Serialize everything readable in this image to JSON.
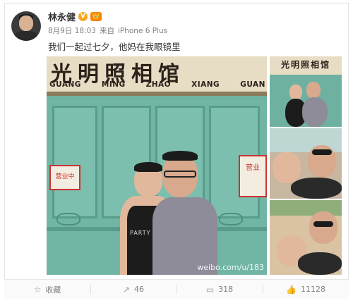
{
  "post": {
    "author": "林永健",
    "verified_badge": "V",
    "member_icon": "👑",
    "date": "8月9日 18:03",
    "source_prefix": "来自",
    "source": "iPhone 6 Plus",
    "text": "我们一起过七夕，他妈在我眼镜里"
  },
  "photo": {
    "sign_cn": "光明照相馆",
    "sign_en": [
      "GUANG",
      "MING",
      "ZHAO",
      "XIANG",
      "GUAN"
    ],
    "notice_left": "营业中",
    "notice_right": "营业",
    "vest_text": "PARTY",
    "watermark": "weibo.com/u/183",
    "thumb_sign": "光明照相馆"
  },
  "actions": [
    {
      "icon": "star-icon",
      "glyph": "☆",
      "label": "收藏"
    },
    {
      "icon": "share-icon",
      "glyph": "↗",
      "label": "46"
    },
    {
      "icon": "comment-icon",
      "glyph": "▭",
      "label": "318"
    },
    {
      "icon": "like-icon",
      "glyph": "👍",
      "label": "11128"
    }
  ],
  "colors": {
    "accent": "#ff8200",
    "verified": "#f6a623",
    "text_muted": "#808080"
  }
}
